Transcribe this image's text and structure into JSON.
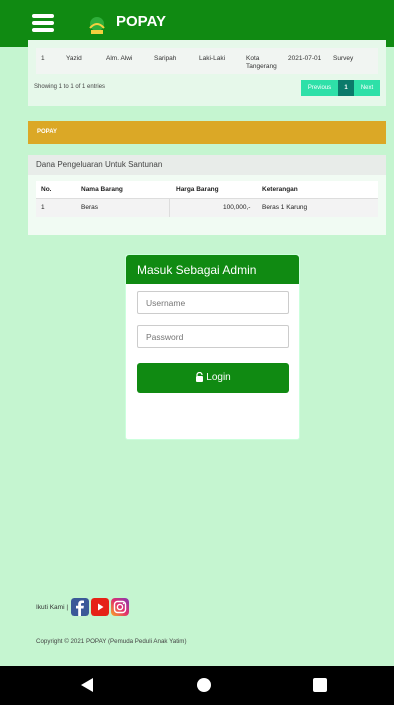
{
  "app": {
    "title": "POPAY"
  },
  "table1": {
    "row": [
      "1",
      "Yazid",
      "Alm. Alwi",
      "Saripah",
      "Laki-Laki",
      "Kota Tangerang",
      "2021-07-01",
      "Survey"
    ],
    "showing": "Showing 1 to 1 of 1 entries",
    "pagination": {
      "previous": "Previous",
      "current": "1",
      "next": "Next"
    }
  },
  "section": {
    "bar_title": "POPAY",
    "panel_title": "Dana Pengeluaran Untuk Santunan"
  },
  "table2": {
    "headers": [
      "No.",
      "Nama Barang",
      "Harga Barang",
      "Keterangan"
    ],
    "rows": [
      [
        "1",
        "Beras",
        "100,000,-",
        "Beras 1 Karung"
      ]
    ]
  },
  "login": {
    "title": "Masuk Sebagai Admin",
    "username_placeholder": "Username",
    "password_placeholder": "Password",
    "button": "Login"
  },
  "footer": {
    "follow_label": "Ikuti Kami |",
    "copyright": "Copyright © 2021 POPAY (Pemuda Peduli Anak Yatim)"
  },
  "colors": {
    "primary": "#108a12",
    "accent": "#dba826",
    "background": "#c5f5d0",
    "pager": "#2ee0a8"
  },
  "icons": [
    "menu-icon",
    "logo-icon",
    "lock-icon",
    "facebook-icon",
    "youtube-icon",
    "instagram-icon",
    "back-icon",
    "home-icon",
    "recents-icon"
  ]
}
